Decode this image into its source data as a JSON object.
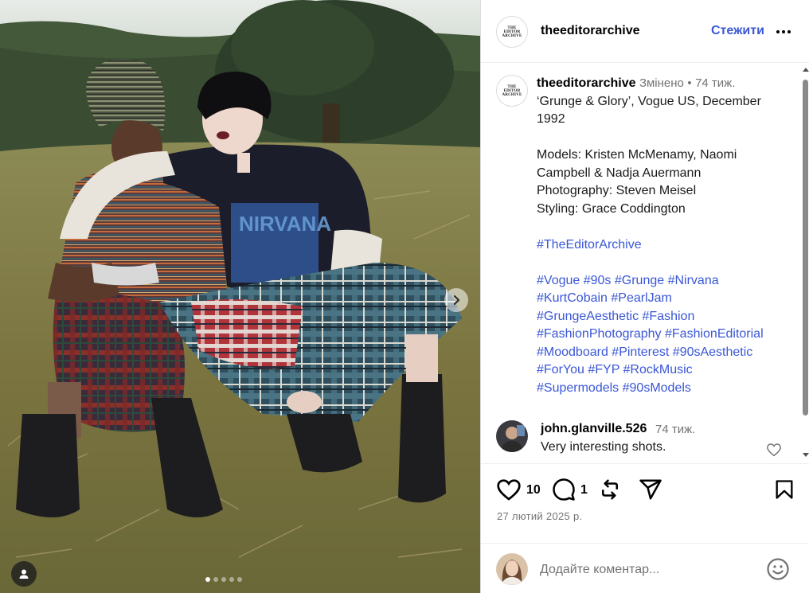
{
  "post": {
    "author": "theeditorarchive",
    "logo_lines": [
      "THE",
      "EDITOR",
      "ARCHIVE"
    ],
    "follow_label": "Стежити",
    "edited_label": "Змінено",
    "separator": "•",
    "post_time": "74 тиж.",
    "caption_lines": [
      "‘Grunge & Glory’, Vogue US, December",
      "1992",
      "",
      "Models: Kristen McMenamy, Naomi",
      "Campbell & Nadja Auermann",
      "Photography: Steven Meisel",
      "Styling: Grace Coddington"
    ],
    "hashtag_lines": [
      "#TheEditorArchive",
      "",
      "#Vogue #90s #Grunge #Nirvana",
      "#KurtCobain #PearlJam",
      "#GrungeAesthetic #Fashion",
      "#FashionPhotography #FashionEditorial",
      "#Moodboard #Pinterest #90sAesthetic",
      "#ForYou #FYP #RockMusic",
      "#Supermodels #90sModels"
    ]
  },
  "comment": {
    "user": "john.glanville.526",
    "time": "74 тиж.",
    "text": "Very interesting shots."
  },
  "actions": {
    "like_count": "10",
    "comment_count": "1",
    "date": "27 лютий 2025 р."
  },
  "composer": {
    "placeholder": "Додайте коментар..."
  },
  "carousel": {
    "slide_count": 5,
    "active_index": 0
  },
  "icons": {
    "like": "heart-icon",
    "comment": "comment-icon",
    "repost": "repost-icon",
    "share": "send-icon",
    "save": "bookmark-icon",
    "emoji": "emoji-icon",
    "more": "more-dots-icon",
    "next": "chevron-right-icon",
    "tags": "user-tag-icon"
  },
  "colors": {
    "accent": "#3a57d6",
    "muted": "#737373"
  }
}
